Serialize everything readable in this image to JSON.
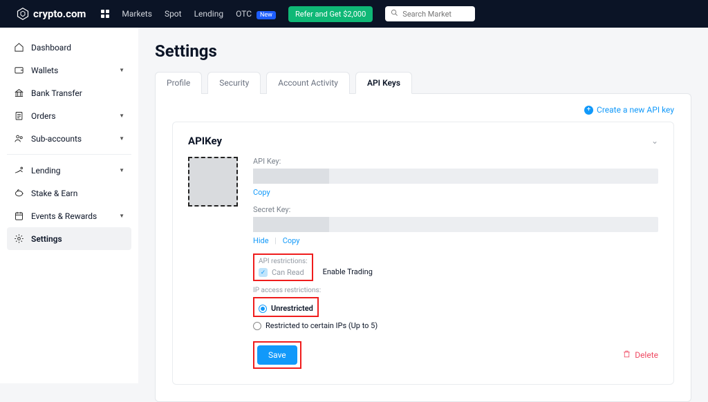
{
  "topnav": {
    "brand": "crypto.com",
    "items": [
      "Markets",
      "Spot",
      "Lending",
      "OTC"
    ],
    "new_badge": "New",
    "refer": "Refer and Get $2,000",
    "search_placeholder": "Search Market"
  },
  "sidebar": {
    "items": [
      {
        "label": "Dashboard",
        "expandable": false
      },
      {
        "label": "Wallets",
        "expandable": true
      },
      {
        "label": "Bank Transfer",
        "expandable": false
      },
      {
        "label": "Orders",
        "expandable": true
      },
      {
        "label": "Sub-accounts",
        "expandable": true
      },
      {
        "label": "Lending",
        "expandable": true
      },
      {
        "label": "Stake & Earn",
        "expandable": false
      },
      {
        "label": "Events & Rewards",
        "expandable": true
      },
      {
        "label": "Settings",
        "expandable": false
      }
    ]
  },
  "page": {
    "title": "Settings"
  },
  "tabs": [
    "Profile",
    "Security",
    "Account Activity",
    "API Keys"
  ],
  "active_tab": 3,
  "panel": {
    "create_label": "Create a new API key",
    "key_title": "APIKey",
    "api_key_label": "API Key:",
    "secret_key_label": "Secret Key:",
    "copy": "Copy",
    "hide": "Hide",
    "api_restrictions_label": "API restrictions:",
    "can_read": "Can Read",
    "enable_trading": "Enable Trading",
    "ip_restrictions_label": "IP access restrictions:",
    "unrestricted": "Unrestricted",
    "restricted": "Restricted to certain IPs (Up to 5)",
    "save": "Save",
    "delete": "Delete"
  }
}
